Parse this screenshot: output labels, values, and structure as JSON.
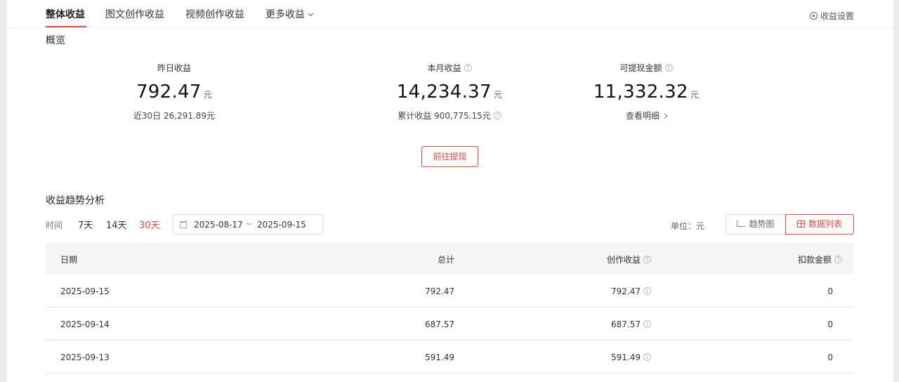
{
  "tabs": [
    {
      "label": "整体收益",
      "active": true
    },
    {
      "label": "图文创作收益",
      "active": false
    },
    {
      "label": "视频创作收益",
      "active": false
    },
    {
      "label": "更多收益",
      "active": false
    }
  ],
  "settings_label": "收益设置",
  "overview": {
    "title": "概览",
    "yesterday": {
      "label": "昨日收益",
      "value": "792.47",
      "unit": "元",
      "sub": "近30日 26,291.89元"
    },
    "month": {
      "label": "本月收益",
      "value": "14,234.37",
      "unit": "元",
      "sub": "累计收益 900,775.15元"
    },
    "withdrawable": {
      "label": "可提现金额",
      "value": "11,332.32",
      "unit": "元",
      "sub": "查看明细"
    },
    "withdraw_button": "前往提现"
  },
  "trend": {
    "title": "收益趋势分析",
    "time_label": "时间",
    "ranges": [
      {
        "label": "7天",
        "active": false
      },
      {
        "label": "14天",
        "active": false
      },
      {
        "label": "30天",
        "active": true
      }
    ],
    "date_start": "2025-08-17",
    "date_sep": "~",
    "date_end": "2025-09-15",
    "unit_label": "单位：元",
    "view_trend": "趋势图",
    "view_table": "数据列表"
  },
  "table": {
    "headers": [
      "日期",
      "总计",
      "创作收益",
      "扣款金额"
    ],
    "rows": [
      [
        "2025-09-15",
        "792.47",
        "792.47",
        "0"
      ],
      [
        "2025-09-14",
        "687.57",
        "687.57",
        "0"
      ],
      [
        "2025-09-13",
        "591.49",
        "591.49",
        "0"
      ]
    ]
  },
  "colors": {
    "accent": "#e8453c",
    "header_bg": "#f5f5f5"
  }
}
